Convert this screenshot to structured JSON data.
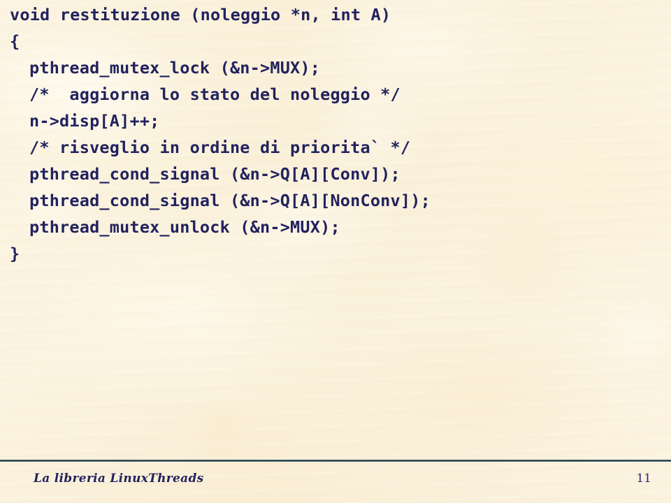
{
  "slide": {
    "background_color": "#faf0d8",
    "text_color": "#22225e",
    "rule_color": "#2e4a52"
  },
  "code": {
    "language": "c",
    "lines": [
      {
        "text": "void restituzione (noleggio *n, int A)",
        "indent": false
      },
      {
        "text": "{",
        "indent": false
      },
      {
        "text": "pthread_mutex_lock (&n->MUX);",
        "indent": true
      },
      {
        "text": "/*  aggiorna lo stato del noleggio */",
        "indent": true
      },
      {
        "text": "n->disp[A]++;",
        "indent": true
      },
      {
        "text": "/* risveglio in ordine di priorita` */",
        "indent": true
      },
      {
        "text": "pthread_cond_signal (&n->Q[A][Conv]);",
        "indent": true
      },
      {
        "text": "pthread_cond_signal (&n->Q[A][NonConv]);",
        "indent": true
      },
      {
        "text": "pthread_mutex_unlock (&n->MUX);",
        "indent": true
      },
      {
        "text": "}",
        "indent": false
      }
    ]
  },
  "footer": {
    "title": "La libreria LinuxThreads",
    "page_number": "11"
  }
}
